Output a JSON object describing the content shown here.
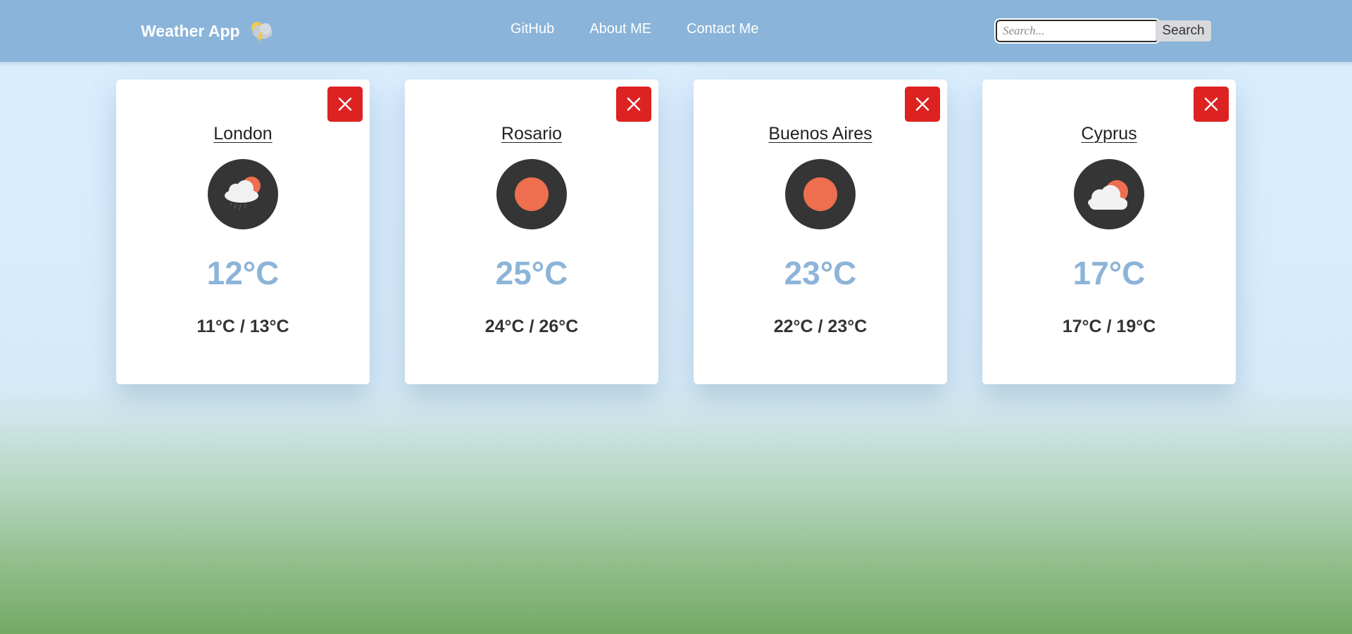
{
  "app": {
    "title": "Weather App",
    "logo_icon": "storm-cloud-icon"
  },
  "nav": {
    "links": [
      {
        "label": "GitHub"
      },
      {
        "label": "About ME"
      },
      {
        "label": "Contact Me"
      }
    ]
  },
  "search": {
    "placeholder": "Search...",
    "value": "",
    "button_label": "Search"
  },
  "colors": {
    "navbar": "#8ab4d9",
    "close_button": "#dd2222",
    "temp_text": "#8db4d8",
    "icon_background": "#353535",
    "sun": "#ee6f4f"
  },
  "cards": [
    {
      "city": "London",
      "icon": "rain-cloud-sun-icon",
      "temp": "12°C",
      "range": "11°C / 13°C"
    },
    {
      "city": "Rosario",
      "icon": "sun-icon",
      "temp": "25°C",
      "range": "24°C / 26°C"
    },
    {
      "city": "Buenos Aires",
      "icon": "sun-icon",
      "temp": "23°C",
      "range": "22°C / 23°C"
    },
    {
      "city": "Cyprus",
      "icon": "cloud-sun-icon",
      "temp": "17°C",
      "range": "17°C / 19°C"
    }
  ]
}
